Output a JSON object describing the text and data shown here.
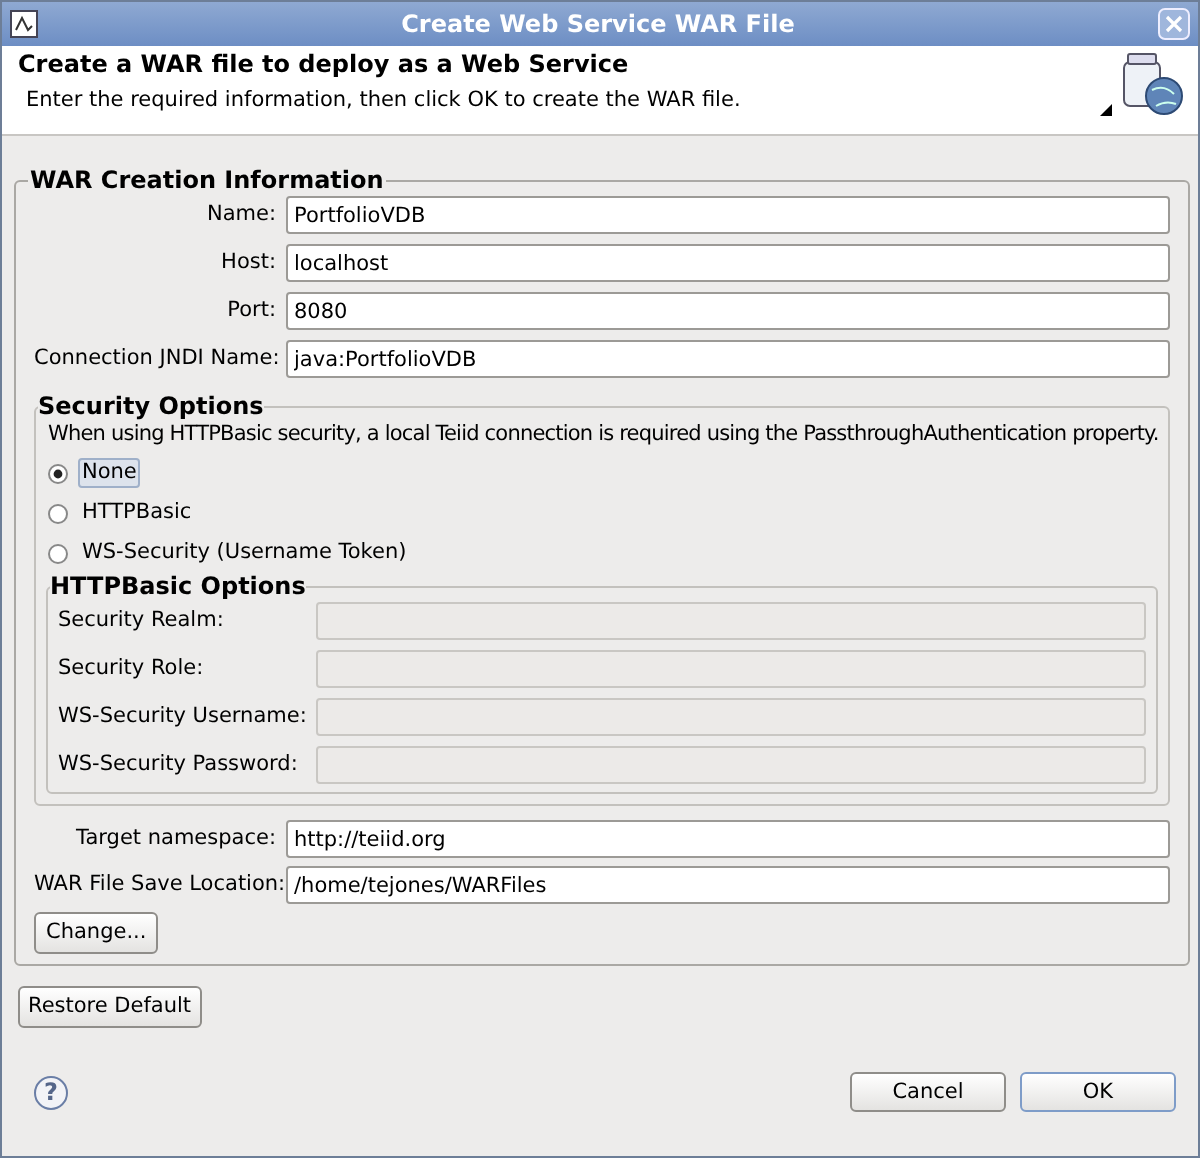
{
  "window": {
    "title": "Create Web Service WAR File"
  },
  "header": {
    "title": "Create a WAR file to deploy as a Web Service",
    "message": "Enter the required information, then click OK to create the WAR file."
  },
  "war_group": {
    "title": "WAR Creation Information",
    "fields": [
      {
        "label": "Name:",
        "value": "PortfolioVDB"
      },
      {
        "label": "Host:",
        "value": "localhost"
      },
      {
        "label": "Port:",
        "value": "8080"
      },
      {
        "label": "Connection JNDI Name:",
        "value": "java:PortfolioVDB"
      }
    ],
    "security": {
      "title": "Security Options",
      "note": "When using HTTPBasic security, a local Teiid connection is required using the PassthroughAuthentication property.",
      "options": [
        {
          "label": "None",
          "selected": true
        },
        {
          "label": "HTTPBasic",
          "selected": false
        },
        {
          "label": "WS-Security (Username Token)",
          "selected": false
        }
      ],
      "httpbasic": {
        "title": "HTTPBasic Options",
        "fields": [
          {
            "label": "Security Realm:",
            "disabled": true
          },
          {
            "label": "Security Role:",
            "disabled": true
          },
          {
            "label": "WS-Security Username:",
            "disabled": true
          },
          {
            "label": "WS-Security Password:",
            "disabled": true
          }
        ]
      }
    },
    "fields_after": [
      {
        "label": "Target namespace:",
        "value": "http://teiid.org"
      },
      {
        "label": "WAR File Save Location:",
        "value": "/home/tejones/WARFiles"
      }
    ],
    "change_button": "Change..."
  },
  "restore_button": "Restore Default",
  "help_glyph": "?",
  "buttons": [
    {
      "label": "Cancel",
      "default": false
    },
    {
      "label": "OK",
      "default": true
    }
  ]
}
